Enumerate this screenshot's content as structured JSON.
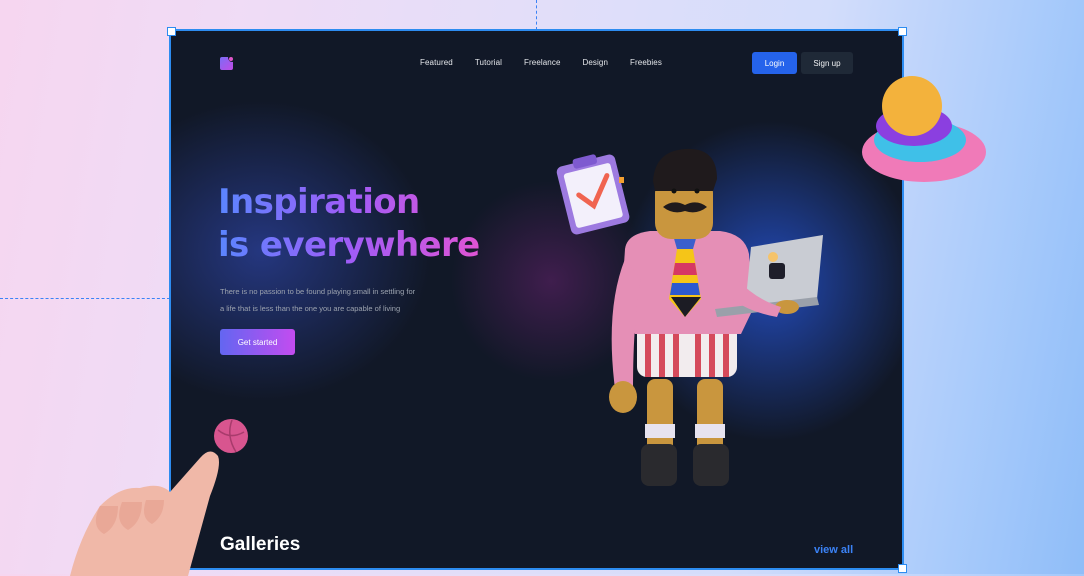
{
  "nav": {
    "items": [
      "Featured",
      "Tutorial",
      "Freelance",
      "Design",
      "Freebies"
    ],
    "login_label": "Login",
    "signup_label": "Sign up"
  },
  "hero": {
    "headline_line1": "Inspiration",
    "headline_line2": "is everywhere",
    "subtext_line1": "There is no passion to be found playing small in settling for",
    "subtext_line2": "a life that is less than the one you are capable of living",
    "cta_label": "Get started"
  },
  "galleries": {
    "title": "Galleries",
    "view_all_label": "view all"
  },
  "colors": {
    "background": "#111827",
    "accent": "#2563eb",
    "gradient_start": "#5a86ff",
    "gradient_end": "#e054d4"
  },
  "icons": [
    "logo-mark-icon",
    "character-illustration",
    "layered-rings-decoration",
    "hand-with-ball-decoration"
  ]
}
